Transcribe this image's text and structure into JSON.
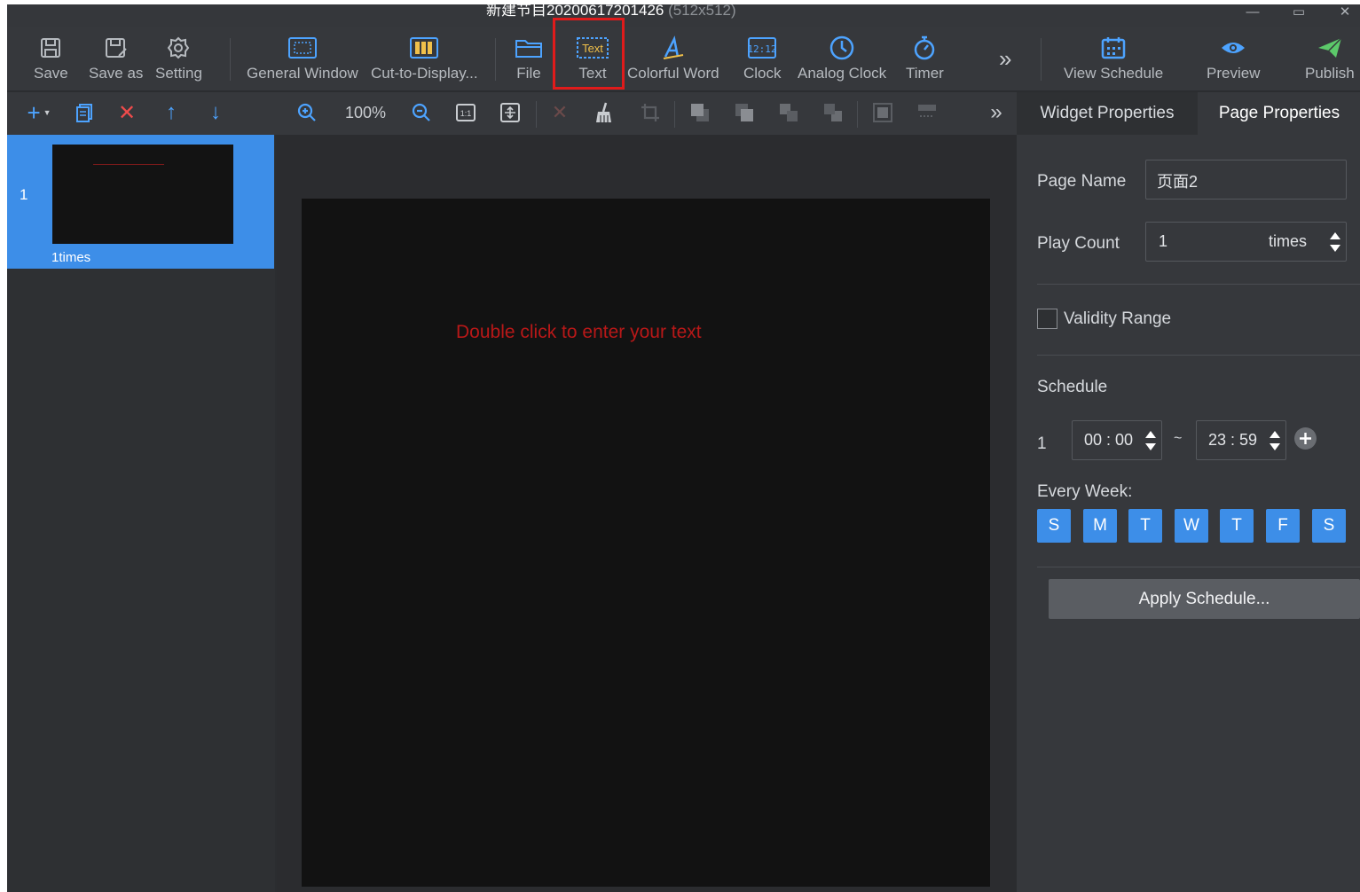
{
  "window": {
    "title": "新建节目20200617201426",
    "resolution": "(512x512)",
    "min_glyph": "—",
    "max_glyph": "▭",
    "close_glyph": "✕"
  },
  "toolbar": {
    "save": "Save",
    "save_as": "Save as",
    "setting": "Setting",
    "general_window": "General Window",
    "cut_to_display": "Cut-to-Display...",
    "file": "File",
    "text": "Text",
    "colorful_word": "Colorful Word",
    "clock": "Clock",
    "analog_clock": "Analog Clock",
    "timer": "Timer",
    "more": "»",
    "view_schedule": "View Schedule",
    "preview": "Preview",
    "publish": "Publish"
  },
  "toolbar2": {
    "zoom_level": "100%",
    "more": "»"
  },
  "pages": [
    {
      "number": "1",
      "times": "1times"
    }
  ],
  "canvas": {
    "placeholder": "Double click to enter your text"
  },
  "right_panel": {
    "tabs": [
      "Widget Properties",
      "Page Properties"
    ],
    "page_name_label": "Page Name",
    "page_name_value": "页面2",
    "play_count_label": "Play Count",
    "play_count_value": "1",
    "play_count_unit": "times",
    "validity_range_label": "Validity Range",
    "schedule_label": "Schedule",
    "schedule_rows": [
      {
        "index": "1",
        "start": "00 : 00",
        "separator": "~",
        "end": "23 : 59"
      }
    ],
    "every_week_label": "Every Week:",
    "week_days": [
      "S",
      "M",
      "T",
      "W",
      "T",
      "F",
      "S"
    ],
    "apply_schedule": "Apply Schedule..."
  },
  "colors": {
    "accent": "#3d8ee8",
    "highlight_box": "#e01b1b",
    "canvas_text": "#b81818"
  }
}
